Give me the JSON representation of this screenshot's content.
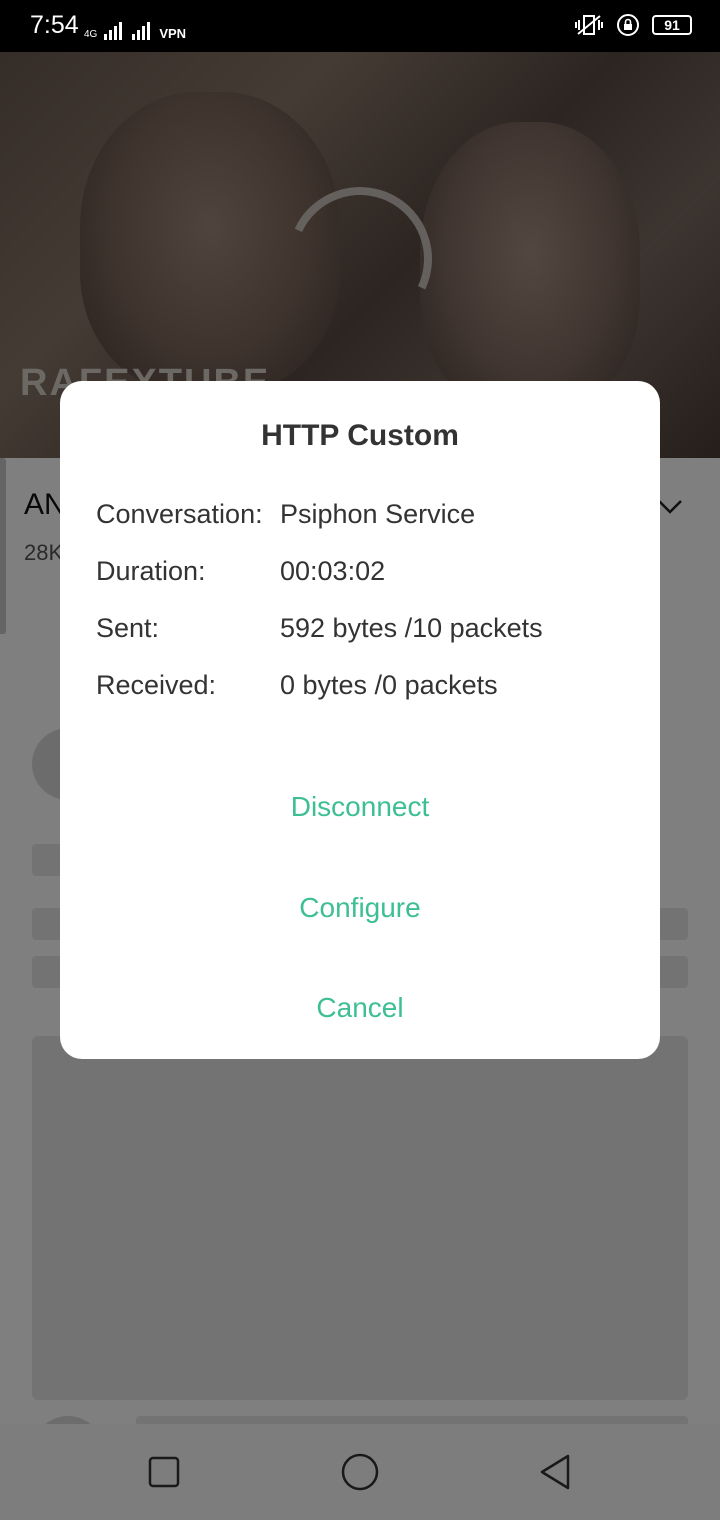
{
  "status_bar": {
    "time": "7:54",
    "network_label": "4G",
    "vpn_label": "VPN",
    "battery_level": "91"
  },
  "background_app": {
    "video_watermark": "RAFEXTUBE",
    "video_title_fragment": "AN",
    "video_views_fragment": "28K"
  },
  "dialog": {
    "title": "HTTP Custom",
    "rows": [
      {
        "label": "Conversation:",
        "value": "Psiphon Service"
      },
      {
        "label": "Duration:",
        "value": "00:03:02"
      },
      {
        "label": "Sent:",
        "value": "592 bytes /10 packets"
      },
      {
        "label": "Received:",
        "value": "0 bytes /0 packets"
      }
    ],
    "actions": {
      "disconnect": "Disconnect",
      "configure": "Configure",
      "cancel": "Cancel"
    },
    "accent_color": "#3dbf93"
  },
  "nav_bar": {
    "recents_icon": "square-icon",
    "home_icon": "circle-icon",
    "back_icon": "triangle-back-icon"
  }
}
